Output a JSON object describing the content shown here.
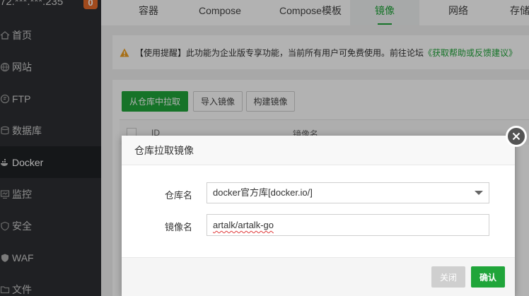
{
  "sidebar": {
    "ip": "72.***.***.235",
    "badge": "0",
    "items": [
      {
        "label": "首页",
        "icon": "home-icon"
      },
      {
        "label": "网站",
        "icon": "globe-icon"
      },
      {
        "label": "FTP",
        "icon": "ftp-icon"
      },
      {
        "label": "数据库",
        "icon": "database-icon"
      },
      {
        "label": "Docker",
        "icon": "docker-icon"
      },
      {
        "label": "监控",
        "icon": "monitor-icon"
      },
      {
        "label": "安全",
        "icon": "shield-icon"
      },
      {
        "label": "WAF",
        "icon": "waf-shield-icon"
      },
      {
        "label": "文件",
        "icon": "folder-icon"
      }
    ],
    "active_index": 4
  },
  "tabs": [
    "容器",
    "Compose",
    "Compose模板",
    "镜像",
    "网络",
    "存储"
  ],
  "active_tab": 3,
  "notice": {
    "text": "【使用提醒】此功能为企业版专享功能，当前所有用户可免费使用。前往论坛",
    "link": "《获取帮助或反馈建议》"
  },
  "toolbar": {
    "pull_label": "从仓库中拉取",
    "import_label": "导入镜像",
    "build_label": "构建镜像"
  },
  "table": {
    "columns": [
      "ID",
      "镜像名"
    ]
  },
  "modal": {
    "title": "仓库拉取镜像",
    "registry_label": "仓库名",
    "registry_value": "docker官方库[docker.io/]",
    "image_label": "镜像名",
    "image_value": "artalk/artalk-go",
    "cancel_label": "关闭",
    "confirm_label": "确认"
  },
  "colors": {
    "accent": "#20a53a",
    "sidebar_bg": "#2d2f33",
    "warning": "#f0a020"
  }
}
